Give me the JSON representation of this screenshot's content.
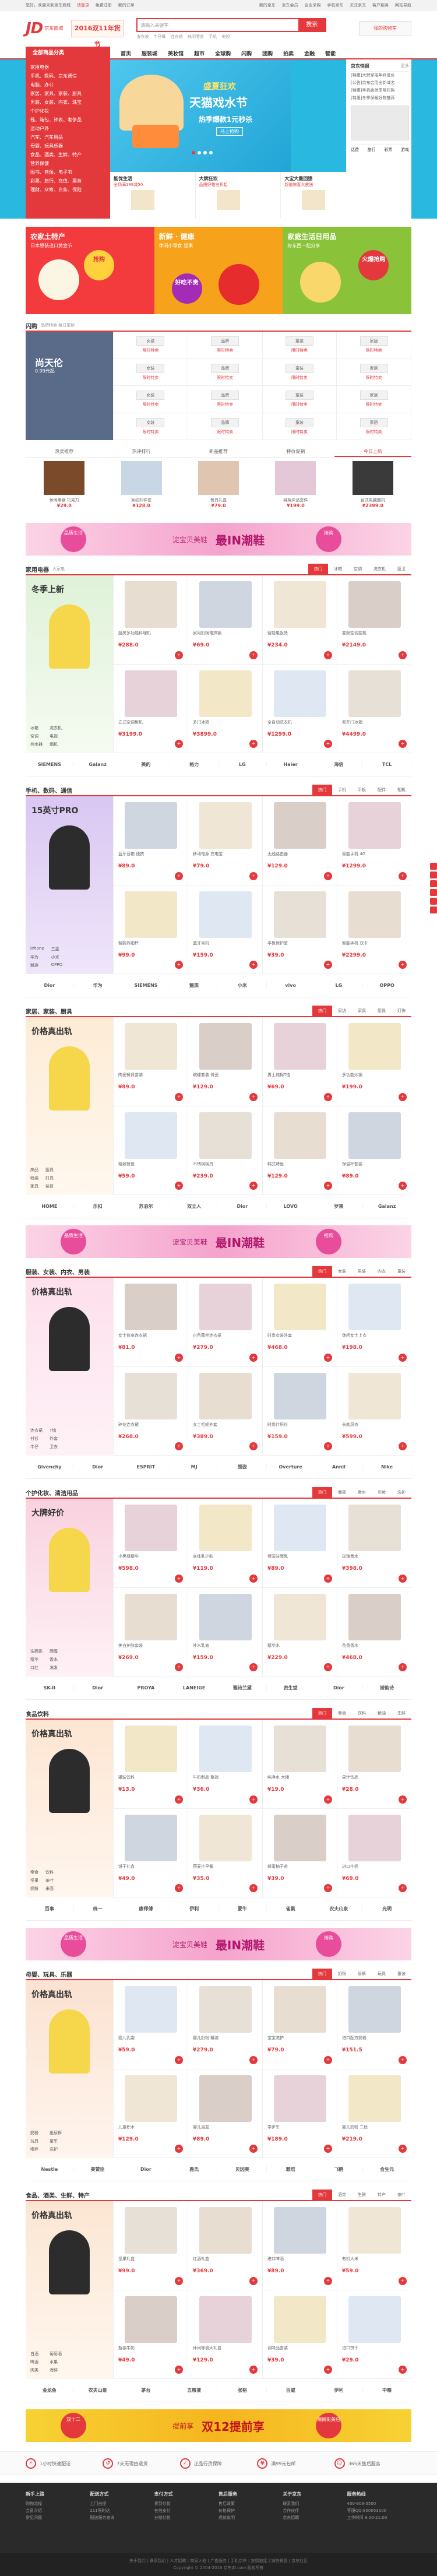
{
  "topbar": {
    "left": [
      "您好，欢迎来到京东商城",
      "请登录",
      "免费注册",
      "我的订单"
    ],
    "right": [
      "我的京东",
      "京东会员",
      "企业采购",
      "手机京东",
      "关注京东",
      "客户服务",
      "网站导航"
    ]
  },
  "header": {
    "logo": "JD",
    "logo_sub": "京东商城",
    "promo": "2016双11年货节",
    "search_placeholder": "请输入关键字",
    "search_btn": "搜索",
    "hot": [
      "洗衣液",
      "牛仔裤",
      "连衣裙",
      "休闲零食",
      "手机",
      "电视"
    ],
    "cart": "我的购物车"
  },
  "nav": {
    "all": "全部商品分类",
    "items": [
      "首页",
      "服装城",
      "美妆馆",
      "超市",
      "全球购",
      "闪购",
      "团购",
      "拍卖",
      "金融",
      "智能"
    ]
  },
  "cats": [
    "家用电器",
    "手机、数码、京东通信",
    "电脑、办公",
    "家居、家具、家装、厨具",
    "男装、女装、内衣、珠宝",
    "个护化妆",
    "鞋、箱包、钟表、奢侈品",
    "运动户外",
    "汽车、汽车用品",
    "母婴、玩具乐器",
    "食品、酒类、生鲜、特产",
    "营养保健",
    "图书、音像、电子书",
    "彩票、旅行、充值、票务",
    "理财、众筹、白条、保险"
  ],
  "slide": {
    "s1": "盛夏狂欢",
    "s2": "天猫戏水节",
    "s3": "热季爆款1元秒杀",
    "s4": "马上抢购"
  },
  "subads": [
    {
      "t": "能优生活",
      "d": "全场满199减50"
    },
    {
      "t": "大牌狂欢",
      "d": "品质好物五折起"
    },
    {
      "t": "大宝大量回馈",
      "d": "超值惊喜大放送"
    }
  ],
  "side": {
    "title": "京东快报",
    "more": "更多",
    "news": [
      "[特惠]大牌家电年终低价",
      "[公告]京东启用全新域名",
      "[特惠]手机疯抢季限时购",
      "[特惠]冬季保暖好物推荐"
    ],
    "tabs": [
      "话费",
      "旅行",
      "彩票",
      "游戏"
    ]
  },
  "tiles": [
    {
      "t": "农家土特产",
      "d": "日本原装进口黄金节",
      "bub": "抢购"
    },
    {
      "t": "新鲜 · 健康",
      "d": "休闲小零食 坚果",
      "bub": "好吃不贵"
    },
    {
      "t": "家庭生活日用品",
      "d": "好东西一起分享",
      "bub": "火爆抢购"
    }
  ],
  "flash": {
    "title": "闪购",
    "sub": "品牌特卖 每日更新",
    "big": "尚天伦",
    "big_sub": "0.99元起",
    "logos": [
      "女装",
      "品牌",
      "童装",
      "家居",
      "女装",
      "品牌",
      "童装",
      "家居",
      "女装",
      "品牌",
      "童装",
      "家居",
      "女装",
      "品牌",
      "童装",
      "家居"
    ],
    "tag": "限时特卖"
  },
  "strip": {
    "tabs": [
      "热卖推荐",
      "热评排行",
      "新品推荐",
      "特价促销",
      "今日上新"
    ],
    "items": [
      {
        "n": "休闲零食 巧克力",
        "p": "¥29.0"
      },
      {
        "n": "家纺四件套",
        "p": "¥128.0"
      },
      {
        "n": "餐具礼盒",
        "p": "¥79.0"
      },
      {
        "n": "纯棉床品套件",
        "p": "¥199.0"
      },
      {
        "n": "台式电脑整机",
        "p": "¥2399.0"
      }
    ]
  },
  "ad1": {
    "l": "品质生活",
    "m": "淀宝贝美鞋",
    "b": "最IN潮鞋",
    "r": "抢购"
  },
  "ad2": {
    "l": "品质生活",
    "m": "淀宝贝美鞋",
    "b": "最IN潮鞋",
    "r": "抢购"
  },
  "ad3": {
    "l": "品质生活",
    "m": "淀宝贝美鞋",
    "b": "最IN潮鞋",
    "r": "抢购"
  },
  "ad4": {
    "l": "双十二",
    "m": "提前享",
    "b": "双12提前享",
    "r": "潮尚街美包"
  },
  "floors": [
    {
      "t": "家用电器",
      "s": "大家电",
      "tt": "冬季上新",
      "tabs": [
        "热门",
        "冰箱",
        "空调",
        "洗衣机",
        "厨卫"
      ],
      "kw": [
        "冰箱",
        "洗衣机",
        "空调",
        "电视",
        "热水器",
        "烟机"
      ],
      "items": [
        {
          "n": "厨房多功能料理机",
          "p": "¥288.0"
        },
        {
          "n": "家用奶锅电热锅",
          "p": "¥69.0"
        },
        {
          "n": "智能电饭煲",
          "p": "¥234.0"
        },
        {
          "n": "变频空调挂机",
          "p": "¥2149.0"
        },
        {
          "n": "立式空调柜机",
          "p": "¥3199.0"
        },
        {
          "n": "多门冰箱",
          "p": "¥3899.0"
        },
        {
          "n": "全自动洗衣机",
          "p": "¥1299.0"
        },
        {
          "n": "双开门冰箱",
          "p": "¥4499.0"
        }
      ],
      "brands": [
        "SIEMENS",
        "Galanz",
        "美的",
        "格力",
        "LG",
        "Haier",
        "海信",
        "TCL"
      ]
    },
    {
      "t": "手机、数码、通信",
      "s": "",
      "tt": "15英寸PRO",
      "tabs": [
        "热门",
        "手机",
        "平板",
        "配件",
        "相机"
      ],
      "kw": [
        "iPhone",
        "三星",
        "华为",
        "小米",
        "魅族",
        "OPPO"
      ],
      "items": [
        {
          "n": "蓝牙音箱 便携",
          "p": "¥89.0"
        },
        {
          "n": "移动电源 充电宝",
          "p": "¥79.0"
        },
        {
          "n": "无线路由器",
          "p": "¥129.0"
        },
        {
          "n": "智能手机 4G",
          "p": "¥1299.0"
        },
        {
          "n": "智能体脂秤",
          "p": "¥99.0"
        },
        {
          "n": "蓝牙耳机",
          "p": "¥159.0"
        },
        {
          "n": "平板保护套",
          "p": "¥39.0"
        },
        {
          "n": "智能手机 双卡",
          "p": "¥2299.0"
        }
      ],
      "brands": [
        "Dior",
        "华为",
        "SIEMENS",
        "魅族",
        "小米",
        "vivo",
        "LG",
        "OPPO"
      ]
    },
    {
      "t": "家居、家装、厨具",
      "s": "",
      "tt": "价格真出轨",
      "tabs": [
        "热门",
        "家纺",
        "家具",
        "厨具",
        "灯饰"
      ],
      "kw": [
        "床品",
        "厨具",
        "收纳",
        "灯具",
        "家具",
        "装修"
      ],
      "items": [
        {
          "n": "陶瓷餐具套装",
          "p": "¥89.0"
        },
        {
          "n": "碗碟套装 骨瓷",
          "p": "¥129.0"
        },
        {
          "n": "男士纯棉T恤",
          "p": "¥69.0"
        },
        {
          "n": "多功能炒锅",
          "p": "¥199.0"
        },
        {
          "n": "精致餐盘",
          "p": "¥59.0"
        },
        {
          "n": "不锈钢锅具",
          "p": "¥239.0"
        },
        {
          "n": "韩式烤盘",
          "p": "¥129.0"
        },
        {
          "n": "保温杯套装",
          "p": "¥89.0"
        }
      ],
      "brands": [
        "HOME",
        "乐扣",
        "苏泊尔",
        "双立人",
        "Dior",
        "LOVO",
        "罗莱",
        "Galanz"
      ]
    },
    {
      "t": "服装、女装、内衣、男装",
      "s": "",
      "tt": "价格真出轨",
      "tabs": [
        "热门",
        "女装",
        "男装",
        "内衣",
        "童装"
      ],
      "kw": [
        "连衣裙",
        "T恤",
        "衬衫",
        "外套",
        "牛仔",
        "卫衣"
      ],
      "items": [
        {
          "n": "女士修身连衣裙",
          "p": "¥81.0"
        },
        {
          "n": "白色蕾丝连衣裙",
          "p": "¥279.0"
        },
        {
          "n": "时尚女装外套",
          "p": "¥468.0"
        },
        {
          "n": "休闲女士上衣",
          "p": "¥198.0"
        },
        {
          "n": "碎花连衣裙",
          "p": "¥268.0"
        },
        {
          "n": "女士毛呢外套",
          "p": "¥389.0"
        },
        {
          "n": "时尚针织衫",
          "p": "¥159.0"
        },
        {
          "n": "长款风衣",
          "p": "¥599.0"
        }
      ],
      "brands": [
        "Givenchy",
        "Dior",
        "ESPRIT",
        "MJ",
        "朗姿",
        "Overture",
        "Annil",
        "Nike"
      ]
    },
    {
      "t": "个护化妆、清洁用品",
      "s": "",
      "tt": "大牌好价",
      "tabs": [
        "热门",
        "面部",
        "香水",
        "彩妆",
        "洗护"
      ],
      "kw": [
        "洗面奶",
        "面膜",
        "精华",
        "香水",
        "口红",
        "洗发"
      ],
      "items": [
        {
          "n": "小黑瓶精华",
          "p": "¥598.0"
        },
        {
          "n": "身体乳护肤",
          "p": "¥119.0"
        },
        {
          "n": "保湿洁面乳",
          "p": "¥89.0"
        },
        {
          "n": "玫瑰香水",
          "p": "¥398.0"
        },
        {
          "n": "美白护肤套装",
          "p": "¥269.0"
        },
        {
          "n": "补水乳液",
          "p": "¥159.0"
        },
        {
          "n": "精华水",
          "p": "¥229.0"
        },
        {
          "n": "花香香水",
          "p": "¥468.0"
        }
      ],
      "brands": [
        "SK-II",
        "Dior",
        "PROYA",
        "LANEIGE",
        "雅诗兰黛",
        "资生堂",
        "Dior",
        "娇韵诗"
      ]
    },
    {
      "t": "食品饮料",
      "s": "",
      "tt": "价格真出轨",
      "tabs": [
        "热门",
        "零食",
        "饮料",
        "粮油",
        "生鲜"
      ],
      "kw": [
        "零食",
        "饮料",
        "坚果",
        "茶叶",
        "奶粉",
        "米面"
      ],
      "items": [
        {
          "n": "罐装饮料",
          "p": "¥13.0"
        },
        {
          "n": "牛奶制品 整箱",
          "p": "¥36.0"
        },
        {
          "n": "纯净水 大桶",
          "p": "¥19.0"
        },
        {
          "n": "果汁饮品",
          "p": "¥28.0"
        },
        {
          "n": "饼干礼盒",
          "p": "¥49.0"
        },
        {
          "n": "燕麦片早餐",
          "p": "¥35.0"
        },
        {
          "n": "蜂蜜柚子茶",
          "p": "¥39.0"
        },
        {
          "n": "进口牛奶",
          "p": "¥69.0"
        }
      ],
      "brands": [
        "百事",
        "统一",
        "康师傅",
        "伊利",
        "蒙牛",
        "雀巢",
        "农夫山泉",
        "光明"
      ]
    },
    {
      "t": "母婴、玩具、乐器",
      "s": "",
      "tt": "价格真出轨",
      "tabs": [
        "热门",
        "奶粉",
        "尿裤",
        "玩具",
        "童装"
      ],
      "kw": [
        "奶粉",
        "纸尿裤",
        "玩具",
        "童车",
        "喂养",
        "洗护"
      ],
      "items": [
        {
          "n": "婴儿乳霜",
          "p": "¥59.0"
        },
        {
          "n": "婴儿奶粉 罐装",
          "p": "¥279.0"
        },
        {
          "n": "宝宝洗护",
          "p": "¥79.0"
        },
        {
          "n": "进口配方奶粉",
          "p": "¥151.5"
        },
        {
          "n": "儿童积木",
          "p": "¥129.0"
        },
        {
          "n": "婴儿浴盆",
          "p": "¥89.0"
        },
        {
          "n": "学步车",
          "p": "¥189.0"
        },
        {
          "n": "婴儿奶粉 二段",
          "p": "¥219.0"
        }
      ],
      "brands": [
        "Nestle",
        "美赞臣",
        "Dior",
        "惠氏",
        "贝因美",
        "雅培",
        "飞鹤",
        "合生元"
      ]
    },
    {
      "t": "食品、酒类、生鲜、特产",
      "s": "",
      "tt": "价格真出轨",
      "tabs": [
        "热门",
        "酒类",
        "生鲜",
        "特产",
        "茶叶"
      ],
      "kw": [
        "白酒",
        "葡萄酒",
        "啤酒",
        "水果",
        "肉类",
        "海鲜"
      ],
      "items": [
        {
          "n": "坚果礼盒",
          "p": "¥99.0"
        },
        {
          "n": "红酒礼盒",
          "p": "¥369.0"
        },
        {
          "n": "进口啤酒",
          "p": "¥89.0"
        },
        {
          "n": "有机大米",
          "p": "¥59.0"
        },
        {
          "n": "瓶装牛奶",
          "p": "¥49.0"
        },
        {
          "n": "休闲零食大礼包",
          "p": "¥129.0"
        },
        {
          "n": "调味品套装",
          "p": "¥39.0"
        },
        {
          "n": "进口饼干",
          "p": "¥29.0"
        }
      ],
      "brands": [
        "金龙鱼",
        "农夫山泉",
        "茅台",
        "五粮液",
        "张裕",
        "百威",
        "伊利",
        "中粮"
      ]
    }
  ],
  "svc": [
    "1小时快速配送",
    "7天无理由退货",
    "正品行货保障",
    "满99元包邮",
    "365天售后服务"
  ],
  "foot": [
    {
      "t": "新手上路",
      "l": [
        "购物流程",
        "会员介绍",
        "常见问题"
      ]
    },
    {
      "t": "配送方式",
      "l": [
        "上门自提",
        "211限时达",
        "配送服务查询"
      ]
    },
    {
      "t": "支付方式",
      "l": [
        "货到付款",
        "在线支付",
        "分期付款"
      ]
    },
    {
      "t": "售后服务",
      "l": [
        "售后政策",
        "价格保护",
        "退款说明"
      ]
    },
    {
      "t": "关于京东",
      "l": [
        "联系我们",
        "合作伙伴",
        "京东招聘"
      ]
    },
    {
      "t": "服务热线",
      "l": [
        "400-606-5500",
        "客服QQ:800053100",
        "工作时间 9:00-21:00"
      ]
    }
  ],
  "copy": [
    "关于我们 | 联系我们 | 人才招聘 | 商家入驻 | 广告服务 | 手机京东 | 友情链接 | 销售联盟 | 京东社区",
    "Copyright © 2004-2016 京东JD.com 版权所有"
  ]
}
